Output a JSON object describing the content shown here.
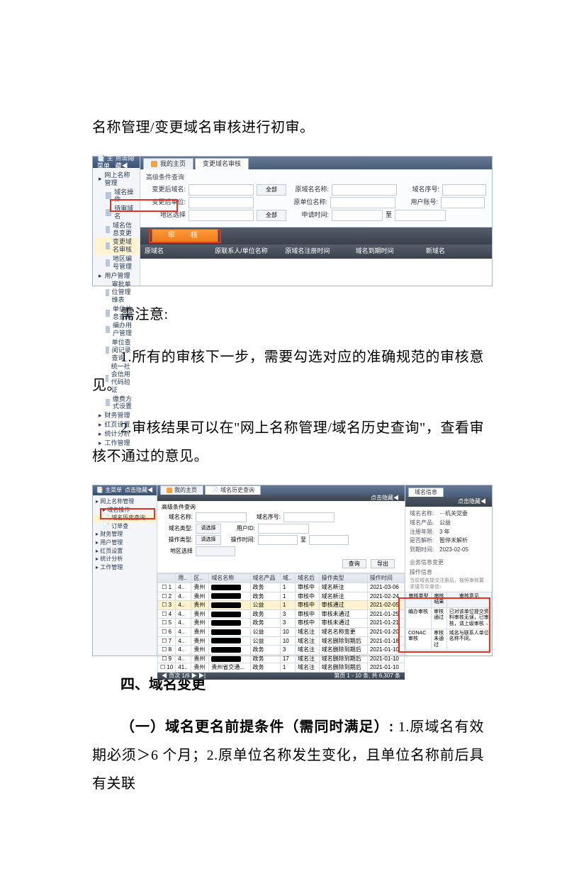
{
  "doc": {
    "intro": "名称管理/变更域名审核进行初审。",
    "note_title": "需注意:",
    "note1": "1.所有的审核下一步，需要勾选对应的准确规范的审核意见。",
    "note2_a": "2.审核结果可以在\"网上名称管理/域名历史查询\"，查看审核不通过的意见。",
    "sec4_title": "四、域名变更",
    "sec4_1_lead": "（一）域名更名前提条件（需同时满足）:",
    "sec4_1_body": " 1.原域名有效期必须＞6 个月；2.原单位名称发生变化，且单位名称前后具有关联"
  },
  "shot1": {
    "menu_title": "主菜单",
    "menu_collapse": "点击隐藏◀",
    "tree": {
      "root": "网上名称管理",
      "i1": "域名操作",
      "i2": "待审域名",
      "i3": "域名信息变更",
      "i4": "变更域名审核",
      "i5": "地区编号管理",
      "i6": "用户管理",
      "i6a": "审批单位管理维表",
      "i6b": "单位信息查询",
      "i6c": "编办用户管理",
      "i6d": "单位查阅记录查询",
      "i6e": "统一社会信用代码验证",
      "i7": "缴费方式设置",
      "i8": "财务管理",
      "i9": "红页设置",
      "i10": "统计分析",
      "i11": "工作管理"
    },
    "tabs": {
      "home": "我的主页",
      "active": "变更域名审核"
    },
    "form": {
      "title": "高级条件查询",
      "f1": "变更后域名:",
      "f2": "原域名名称:",
      "f3": "域名序号:",
      "f4": "变更后单位:",
      "f5": "原单位名称:",
      "f6": "用户账号:",
      "f7": "地区选择",
      "f8": "申请时间:",
      "all": "全部",
      "to": "至"
    },
    "btn": "审　核",
    "cols": {
      "c1": "原域名",
      "c2": "原联系人/单位名称",
      "c3": "原域名注册时间",
      "c4": "域名到期时间",
      "c5": "新域名"
    }
  },
  "shot2": {
    "menu_title": "主菜单",
    "menu_collapse": "点击隐藏◀",
    "tree": {
      "root": "网上名称管理",
      "i1": "域名操作",
      "i2": "域名历史查询",
      "i3": "订单查",
      "g1": "财务管理",
      "g2": "用户管理",
      "g3": "红页设置",
      "g4": "统计分析",
      "g5": "工作管理"
    },
    "tabs": {
      "home": "我的主页",
      "active": "域名历史查询"
    },
    "ribbon": "点击隐藏◀",
    "panel_title": "域名信息",
    "panel_collapse": "点击隐藏◀",
    "form": {
      "title": "高级条件查询",
      "f1": "域名名称:",
      "f2": "域名序号:",
      "f3": "域名类型:",
      "f4": "用户ID:",
      "f5": "操作类型:",
      "f6": "操作时间:",
      "f7": "地区选择",
      "opt_sel": "请选择",
      "to": "至",
      "btn_search": "查询",
      "btn_export": "导出"
    },
    "table": {
      "headers": [
        "",
        "用..",
        "区..",
        "域名名称",
        "域名产品",
        "域..",
        "域名后",
        "操作类型",
        "操作时间"
      ],
      "rows": [
        {
          "n": "1",
          "u": "4..",
          "r": "贵州",
          "name": "",
          "prod": "政务",
          "num": "1",
          "suf": "审核中",
          "op": "域名新注",
          "time": "2021-03-06",
          "hl": false
        },
        {
          "n": "2",
          "u": "4..",
          "r": "贵州",
          "name": "",
          "prod": "政务",
          "num": "1",
          "suf": "审核中",
          "op": "域名新注",
          "time": "2021-02-24",
          "hl": false
        },
        {
          "n": "3",
          "u": "4..",
          "r": "贵州",
          "name": "",
          "prod": "公益",
          "num": "1",
          "suf": "审核中",
          "op": "审核通过",
          "time": "2021-02-05",
          "hl": true
        },
        {
          "n": "4",
          "u": "4..",
          "r": "贵州",
          "name": "",
          "prod": "政务",
          "num": "3",
          "suf": "审核中",
          "op": "审核未通过",
          "time": "2021-01-25",
          "hl": false
        },
        {
          "n": "5",
          "u": "4..",
          "r": "贵州",
          "name": "",
          "prod": "政务",
          "num": "3",
          "suf": "审核中",
          "op": "审核未通过",
          "time": "2021-01-21",
          "hl": false
        },
        {
          "n": "6",
          "u": "4..",
          "r": "贵州",
          "name": "",
          "prod": "公益",
          "num": "10",
          "suf": "域名注",
          "op": "域名名称变更",
          "time": "2021-01-20",
          "hl": false
        },
        {
          "n": "7",
          "u": "4..",
          "r": "贵州",
          "name": "",
          "prod": "公益",
          "num": "10",
          "suf": "域名注",
          "op": "域名删除到期后",
          "time": "2021-01-18",
          "hl": false
        },
        {
          "n": "8",
          "u": "4..",
          "r": "贵州",
          "name": "",
          "prod": "政务",
          "num": "3",
          "suf": "域名注",
          "op": "域名删除到期后",
          "time": "2021-01-10",
          "hl": false
        },
        {
          "n": "9",
          "u": "4..",
          "r": "贵州",
          "name": "",
          "prod": "政务",
          "num": "17",
          "suf": "域名注",
          "op": "域名删除到期后",
          "time": "2021-01-10",
          "hl": false
        },
        {
          "n": "10",
          "u": "41..",
          "r": "贵州",
          "name": "贵州省交通...",
          "prod": "政务",
          "num": "1",
          "suf": "域名注",
          "op": "域名删除到期后",
          "time": "2021-01-10",
          "hl": false
        }
      ],
      "pager_left": "◀ 页次 1/6 ▶ ▶|",
      "pager_right": "第页 1 - 10 条, 共 6,307 条"
    },
    "info": {
      "k1": "域名名称:",
      "v1": "···机关党委",
      "k2": "域名产品:",
      "v2": "公益",
      "k3": "注册年限:",
      "v3": "3 年",
      "k4": "是否解析:",
      "v4": "暂停未解析",
      "k5": "到期时间:",
      "v5": "2023-02-05",
      "sec1": "业务信息变更",
      "sec2": "操作信息",
      "sec2b": "当前域名提交注册后，按照审核要求填写众单信›"
    },
    "audit": {
      "h1": "审核类型",
      "h2": "审核结果",
      "h3": "审核意见",
      "r1a": "编办审核",
      "r1b": "审核通过",
      "r1c": "已对该单位提交资料审核无误，已审核，请上级审核→",
      "r2a": "CONAC审核",
      "r2b": "审核未通过",
      "r2c": "域名与联系人单位名称不同。"
    }
  }
}
